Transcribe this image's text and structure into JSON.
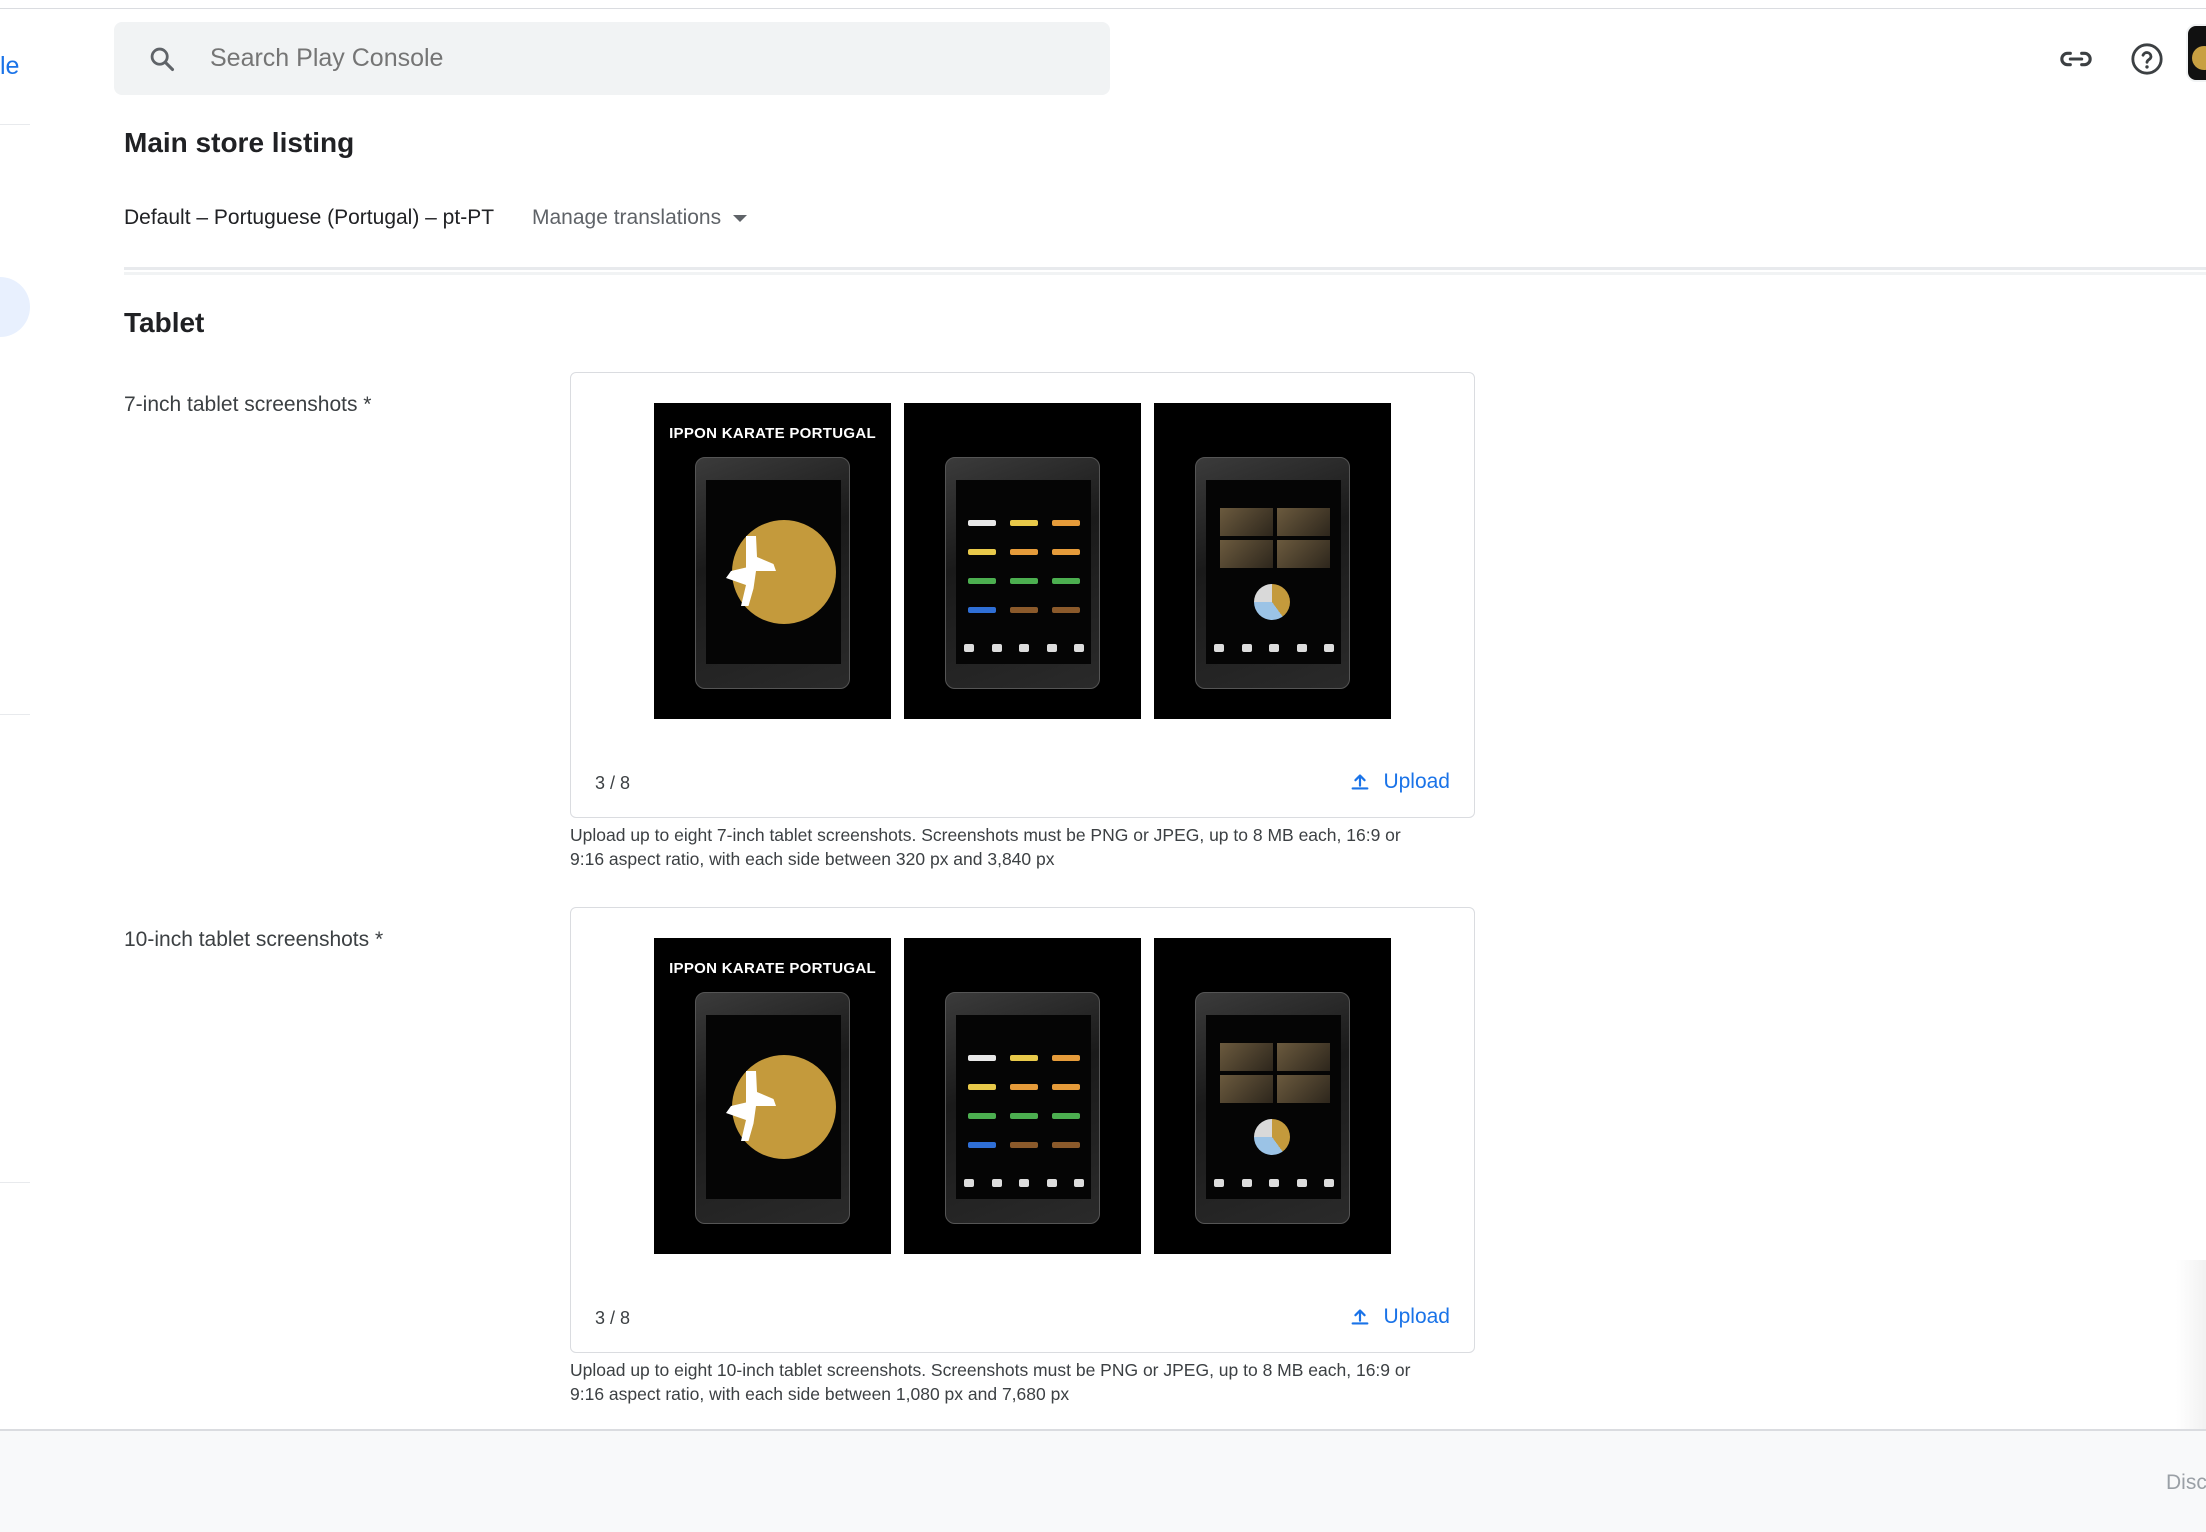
{
  "left_rail": {
    "text": "le"
  },
  "search": {
    "placeholder": "Search Play Console",
    "icon": "search-icon"
  },
  "header_icons": [
    "link-icon",
    "help-icon"
  ],
  "main": {
    "title": "Main store listing",
    "language": "Default – Portuguese (Portugal) – pt-PT",
    "manage_translations": "Manage translations"
  },
  "section": {
    "title": "Tablet",
    "fields": [
      {
        "label": "7-inch tablet screenshots  *",
        "count": "3 / 8",
        "upload_label": "Upload",
        "helper_line1": "Upload up to eight 7-inch tablet screenshots. Screenshots must be PNG or JPEG, up to 8 MB each, 16:9 or",
        "helper_line2": "9:16 aspect ratio, with each side between 320 px and 3,840 px",
        "screenshot_title": "IPPON KARATE PORTUGAL"
      },
      {
        "label": "10-inch tablet screenshots  *",
        "count": "3 / 8",
        "upload_label": "Upload",
        "helper_line1": "Upload up to eight 10-inch tablet screenshots. Screenshots must be PNG or JPEG, up to 8 MB each, 16:9 or",
        "helper_line2": "9:16 aspect ratio, with each side between 1,080 px and 7,680 px",
        "screenshot_title": "IPPON KARATE PORTUGAL"
      }
    ]
  },
  "footer": {
    "button_label": "Disc"
  },
  "colors": {
    "accent": "#1a73e8",
    "gold": "#c49a3c"
  }
}
